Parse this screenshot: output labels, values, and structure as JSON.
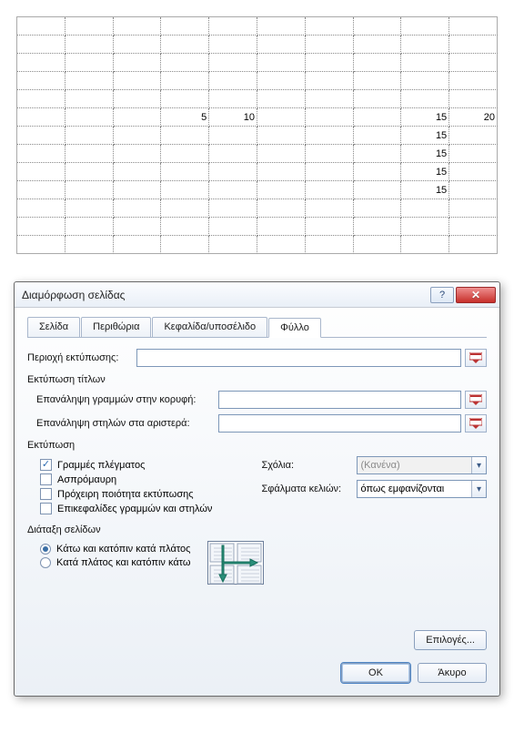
{
  "sheet": {
    "rows": 13,
    "cols": 10,
    "cells": {
      "r6c4": "5",
      "r6c5": "10",
      "r6c9": "15",
      "r6c10": "20",
      "r7c9": "15",
      "r8c9": "15",
      "r9c9": "15",
      "r10c9": "15"
    }
  },
  "dialog": {
    "title": "Διαμόρφωση σελίδας",
    "tabs": {
      "page": "Σελίδα",
      "margins": "Περιθώρια",
      "header_footer": "Κεφαλίδα/υποσέλιδο",
      "sheet": "Φύλλο"
    },
    "print_area_label": "Περιοχή εκτύπωσης:",
    "print_titles_group": "Εκτύπωση τίτλων",
    "rows_repeat_label": "Επανάληψη γραμμών στην κορυφή:",
    "cols_repeat_label": "Επανάληψη στηλών στα αριστερά:",
    "print_group": "Εκτύπωση",
    "cb_gridlines": "Γραμμές πλέγματος",
    "cb_bw": "Ασπρόμαυρη",
    "cb_draft": "Πρόχειρη ποιότητα εκτύπωσης",
    "cb_headings": "Επικεφαλίδες γραμμών και στηλών",
    "comments_label": "Σχόλια:",
    "comments_value": "(Κανένα)",
    "cell_errors_label": "Σφάλματα κελιών:",
    "cell_errors_value": "όπως εμφανίζονται",
    "page_order_group": "Διάταξη σελίδων",
    "order_down_over": "Κάτω και κατόπιν κατά πλάτος",
    "order_over_down": "Κατά πλάτος και κατόπιν κάτω",
    "options_btn": "Επιλογές...",
    "ok_btn": "OK",
    "cancel_btn": "Άκυρο"
  }
}
